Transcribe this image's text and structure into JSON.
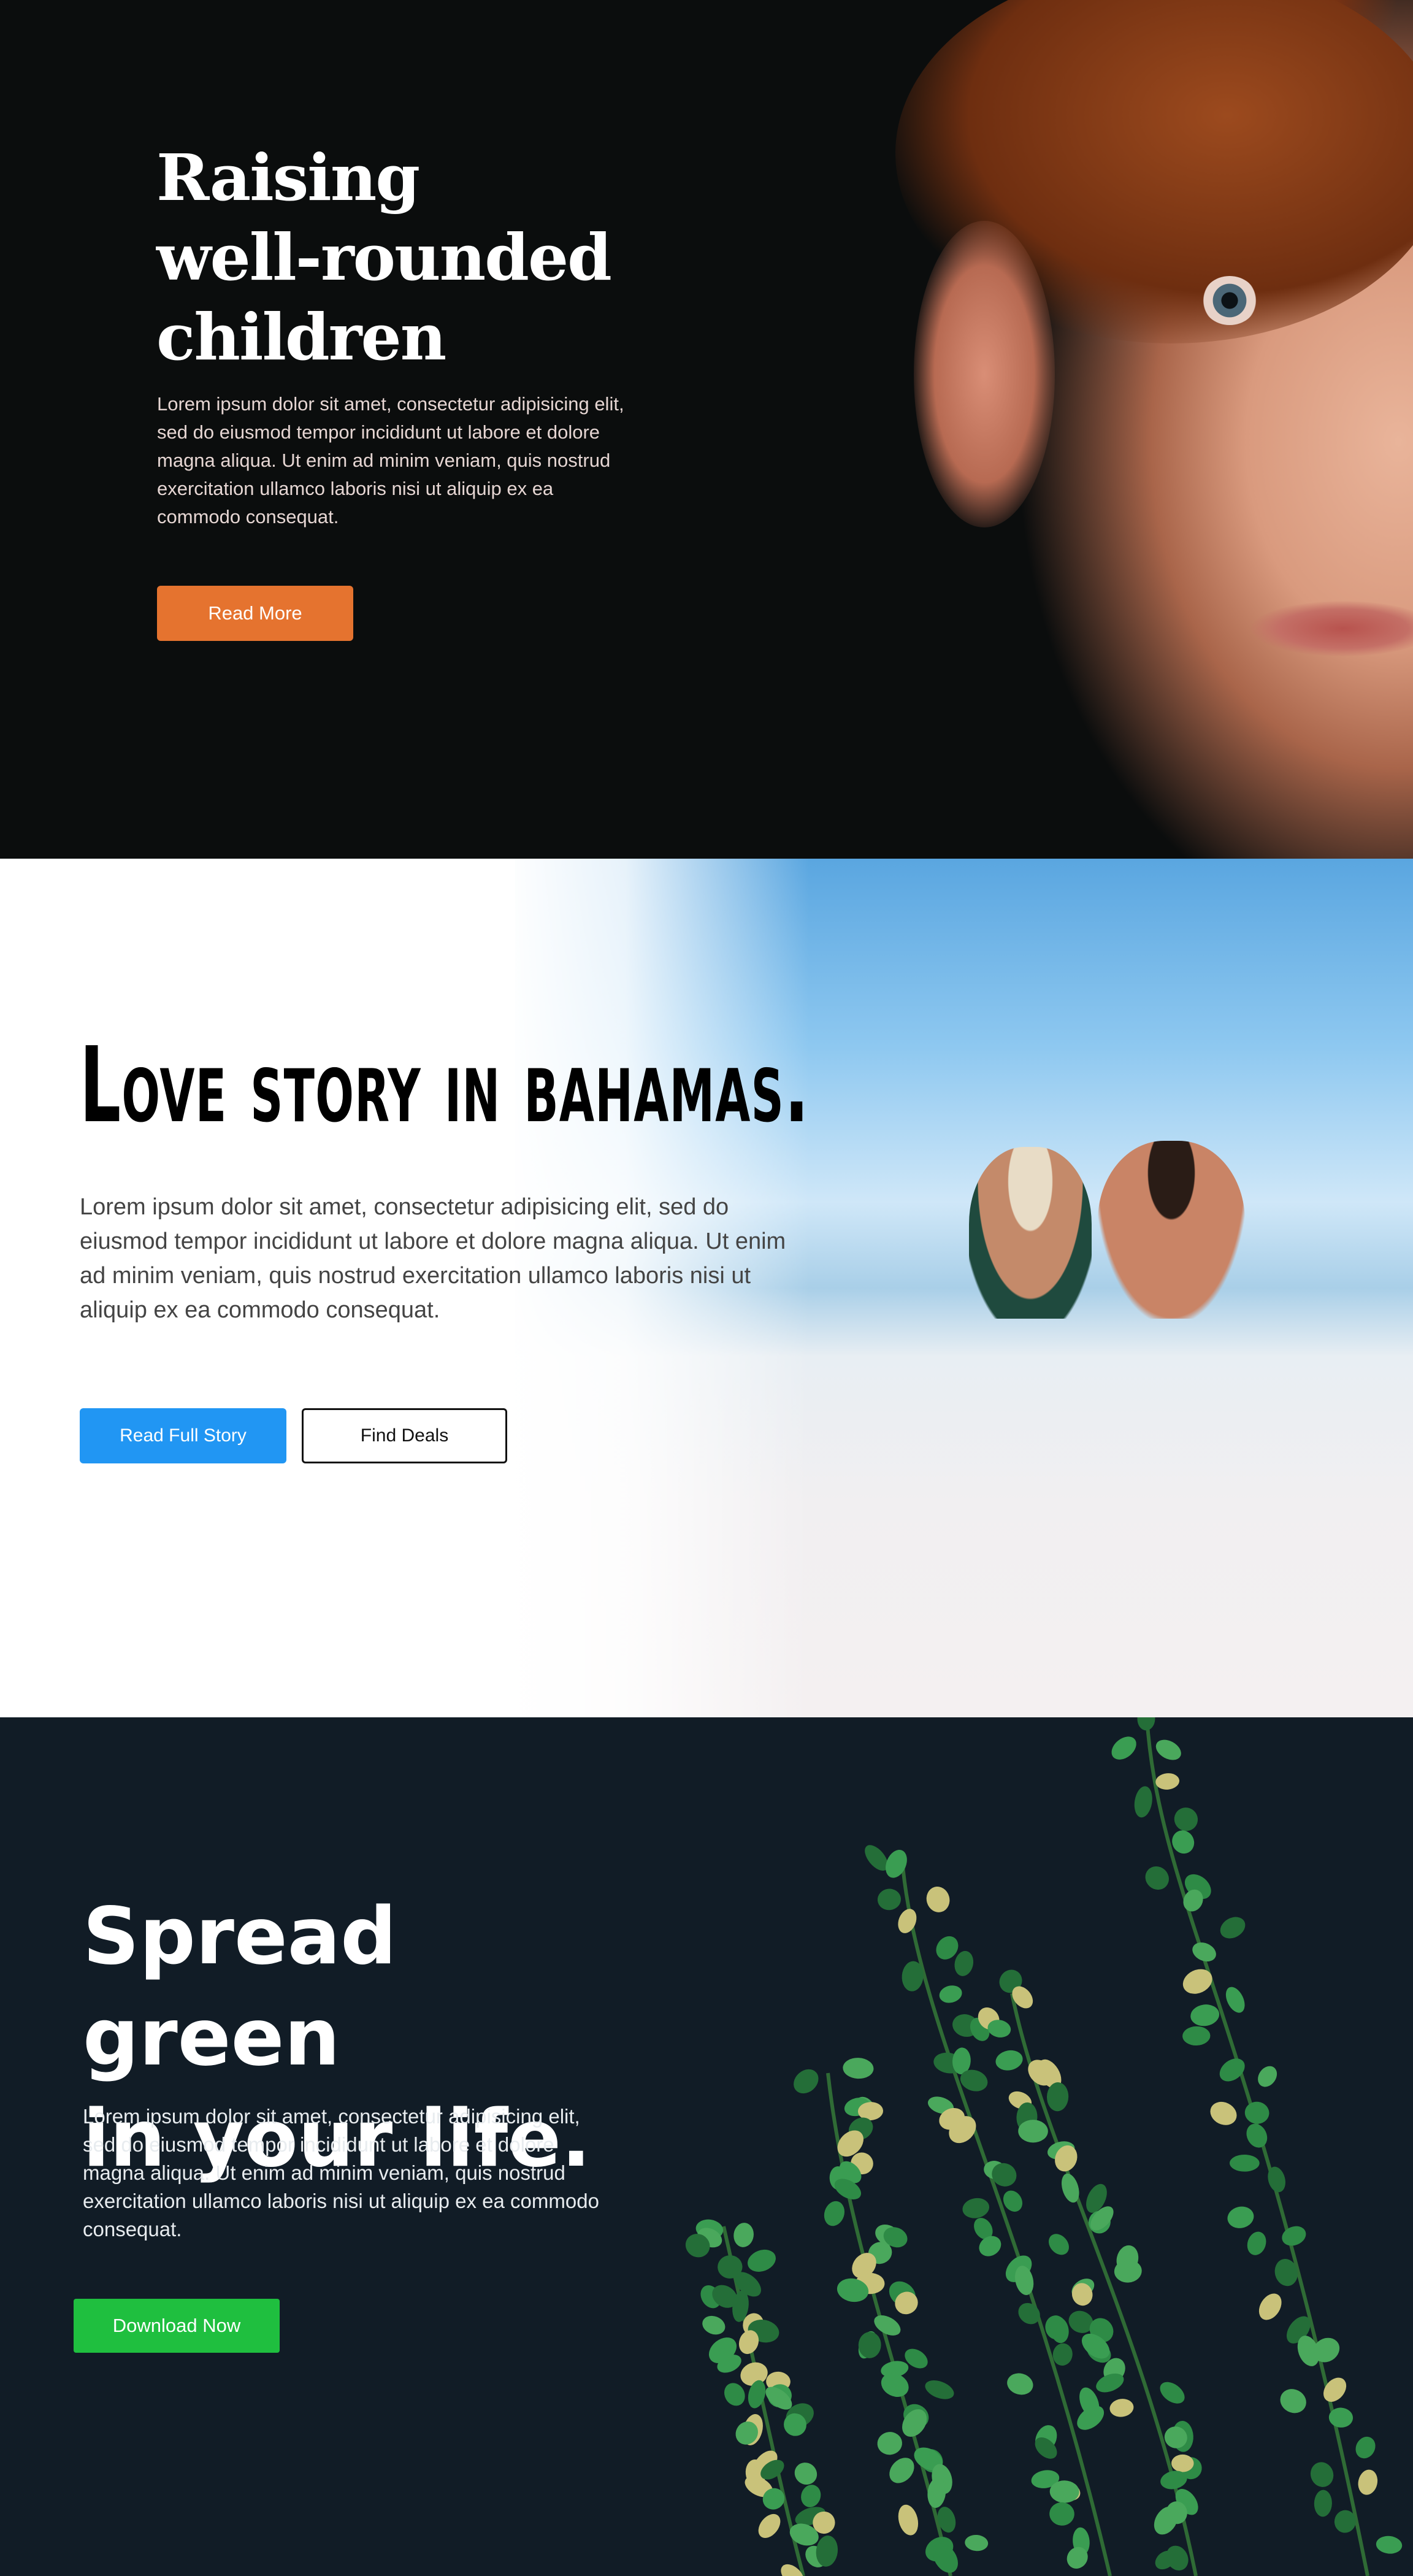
{
  "sections": [
    {
      "title_lines": [
        "Raising",
        "well-rounded",
        "children"
      ],
      "body": "Lorem ipsum dolor sit amet, consectetur adipisicing elit, sed do eiusmod tempor incididunt ut labore et dolore magna aliqua. Ut enim ad minim veniam, quis nostrud exercitation ullamco laboris nisi ut aliquip ex ea commodo consequat.",
      "button": "Read More",
      "accent": "#e5732f"
    },
    {
      "title": "Love story in bahamas.",
      "body": "Lorem ipsum dolor sit amet, consectetur adipisicing elit, sed do eiusmod tempor incididunt ut labore et dolore magna aliqua. Ut enim ad minim veniam, quis nostrud exercitation ullamco laboris nisi ut aliquip ex ea commodo consequat.",
      "primary_button": "Read Full Story",
      "secondary_button": "Find Deals",
      "accent": "#2196f3"
    },
    {
      "title_lines": [
        "Spread green",
        "in your life."
      ],
      "body": "Lorem ipsum dolor sit amet, consectetur adipisicing elit, sed do eiusmod tempor incididunt ut labore et dolore magna aliqua. Ut enim ad minim veniam, quis nostrud exercitation ullamco laboris nisi ut aliquip ex ea commodo consequat.",
      "button": "Download Now",
      "accent": "#1fbf3f"
    }
  ]
}
